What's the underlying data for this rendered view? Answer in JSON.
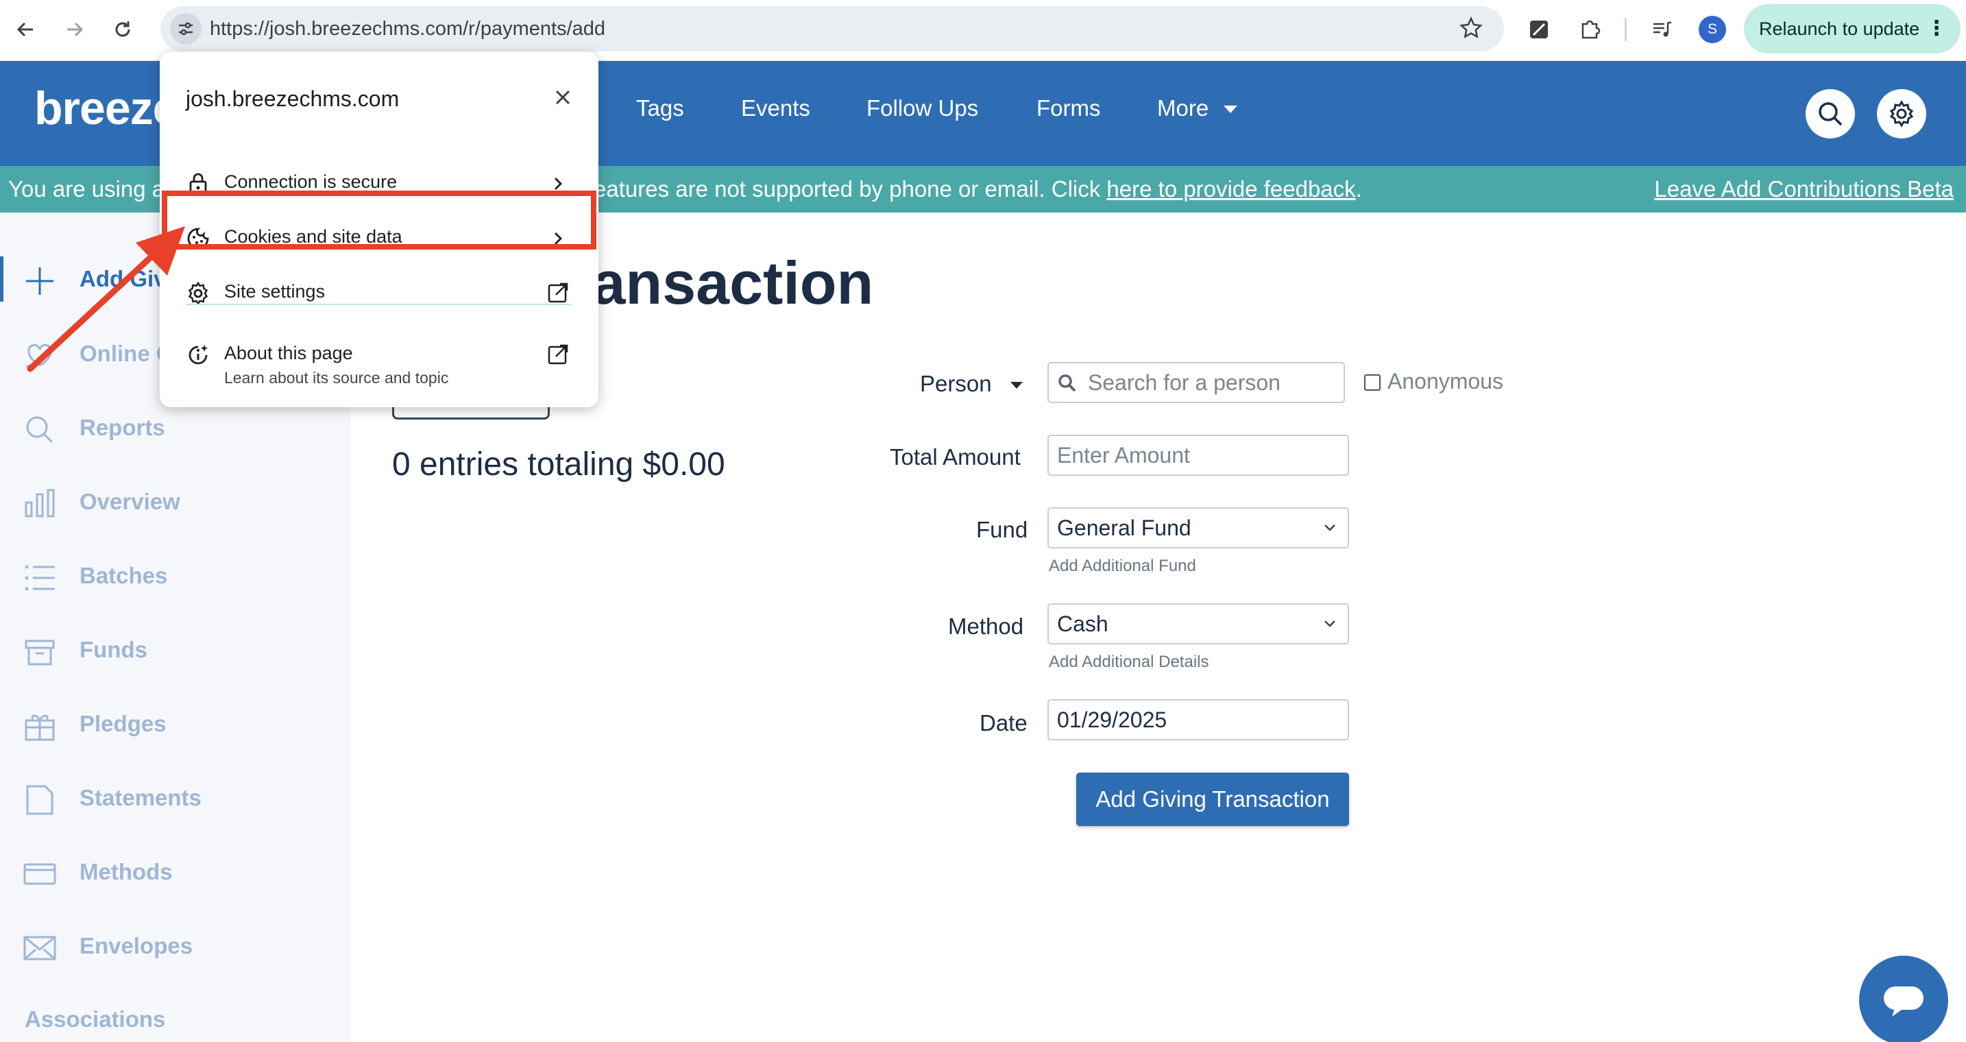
{
  "browser": {
    "url": "https://josh.breezechms.com/r/payments/add",
    "profile_initial": "S",
    "relaunch_label": "Relaunch to update",
    "relaunch_menu": "⋮"
  },
  "header": {
    "logo": "breeze",
    "nav": [
      "Tags",
      "Events",
      "Follow Ups",
      "Forms",
      "More"
    ]
  },
  "banner": {
    "left_text": "You are using a",
    "middle_text": "eatures are not supported by phone or email. Click ",
    "feedback_link": "here to provide feedback",
    "period": ".",
    "leave_link": "Leave Add Contributions Beta"
  },
  "sidebar": {
    "items": [
      {
        "label": "Add Givi",
        "icon": "plus-icon",
        "active": true
      },
      {
        "label": "Online G",
        "icon": "heart-hand-icon",
        "active": false
      },
      {
        "label": "Reports",
        "icon": "search-icon",
        "active": false
      },
      {
        "label": "Overview",
        "icon": "bar-chart-icon",
        "active": false
      },
      {
        "label": "Batches",
        "icon": "list-icon",
        "active": false
      },
      {
        "label": "Funds",
        "icon": "archive-icon",
        "active": false
      },
      {
        "label": "Pledges",
        "icon": "gift-icon",
        "active": false
      },
      {
        "label": "Statements",
        "icon": "document-icon",
        "active": false
      },
      {
        "label": "Methods",
        "icon": "card-icon",
        "active": false
      },
      {
        "label": "Envelopes",
        "icon": "envelope-icon",
        "active": false
      }
    ],
    "section": "Associations"
  },
  "main": {
    "title": "ving Transaction",
    "entries_summary": "0 entries totaling $0.00",
    "form": {
      "person_label": "Person",
      "person_placeholder": "Search for a person",
      "anonymous_label": "Anonymous",
      "amount_label": "Total Amount",
      "amount_placeholder": "Enter Amount",
      "fund_label": "Fund",
      "fund_value": "General Fund",
      "add_fund": "Add Additional Fund",
      "method_label": "Method",
      "method_value": "Cash",
      "add_details": "Add Additional Details",
      "date_label": "Date",
      "date_value": "01/29/2025",
      "submit_label": "Add Giving Transaction"
    }
  },
  "popup": {
    "domain": "josh.breezechms.com",
    "rows": [
      {
        "label": "Connection is secure",
        "icon": "lock-icon"
      },
      {
        "label": "Cookies and site data",
        "icon": "cookie-icon"
      },
      {
        "label": "Site settings",
        "icon": "gear-icon"
      },
      {
        "label": "About this page",
        "sub": "Learn about its source and topic",
        "icon": "info-sparkle-icon"
      }
    ]
  },
  "colors": {
    "brand_blue": "#2e6db4",
    "banner_teal": "#4aa8a8",
    "annotation_red": "#e8402a"
  }
}
